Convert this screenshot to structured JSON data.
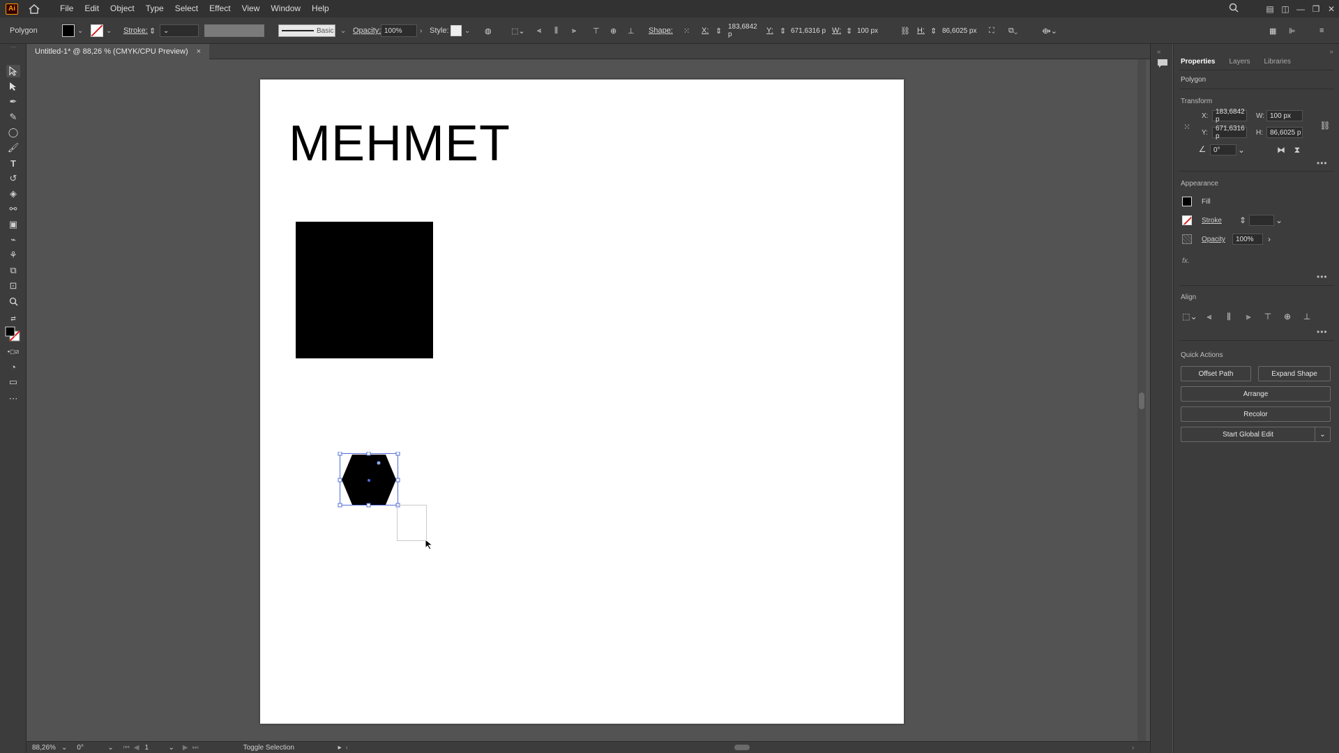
{
  "app": {
    "logo": "Ai"
  },
  "menu": [
    "File",
    "Edit",
    "Object",
    "Type",
    "Select",
    "Effect",
    "View",
    "Window",
    "Help"
  ],
  "control_bar": {
    "selection_type": "Polygon",
    "stroke_label": "Stroke:",
    "brush_label": "Basic",
    "opacity_label": "Opacity:",
    "opacity_value": "100%",
    "style_label": "Style:",
    "shape_label": "Shape:",
    "x_label": "X:",
    "x_value": "183,6842 p",
    "y_label": "Y:",
    "y_value": "671,6316 p",
    "w_label": "W:",
    "w_value": "100 px",
    "h_label": "H:",
    "h_value": "86,6025 px"
  },
  "document_tab": {
    "title": "Untitled-1* @ 88,26 % (CMYK/CPU Preview)",
    "close": "×"
  },
  "canvas": {
    "text": "MEHMET"
  },
  "status_bar": {
    "zoom": "88,26%",
    "rotation": "0°",
    "artboard": "1",
    "message": "Toggle Selection"
  },
  "panel": {
    "tabs": [
      "Properties",
      "Layers",
      "Libraries"
    ],
    "object_type": "Polygon",
    "transform": {
      "heading": "Transform",
      "x_label": "X:",
      "x_value": "183,6842 p",
      "y_label": "Y:",
      "y_value": "671,6316 p",
      "w_label": "W:",
      "w_value": "100 px",
      "h_label": "H:",
      "h_value": "86,6025 p",
      "angle_value": "0°"
    },
    "appearance": {
      "heading": "Appearance",
      "fill_label": "Fill",
      "stroke_label": "Stroke",
      "opacity_label": "Opacity",
      "opacity_value": "100%",
      "fx_label": "fx."
    },
    "align": {
      "heading": "Align"
    },
    "quick_actions": {
      "heading": "Quick Actions",
      "offset_path": "Offset Path",
      "expand_shape": "Expand Shape",
      "arrange": "Arrange",
      "recolor": "Recolor",
      "global_edit": "Start Global Edit"
    }
  },
  "colors": {
    "ui_dark": "#323232",
    "panel": "#3c3c3c",
    "canvas_bg": "#535353",
    "artboard": "#ffffff",
    "selection": "#4f6ed8",
    "ai_orange": "#ff9a00"
  }
}
